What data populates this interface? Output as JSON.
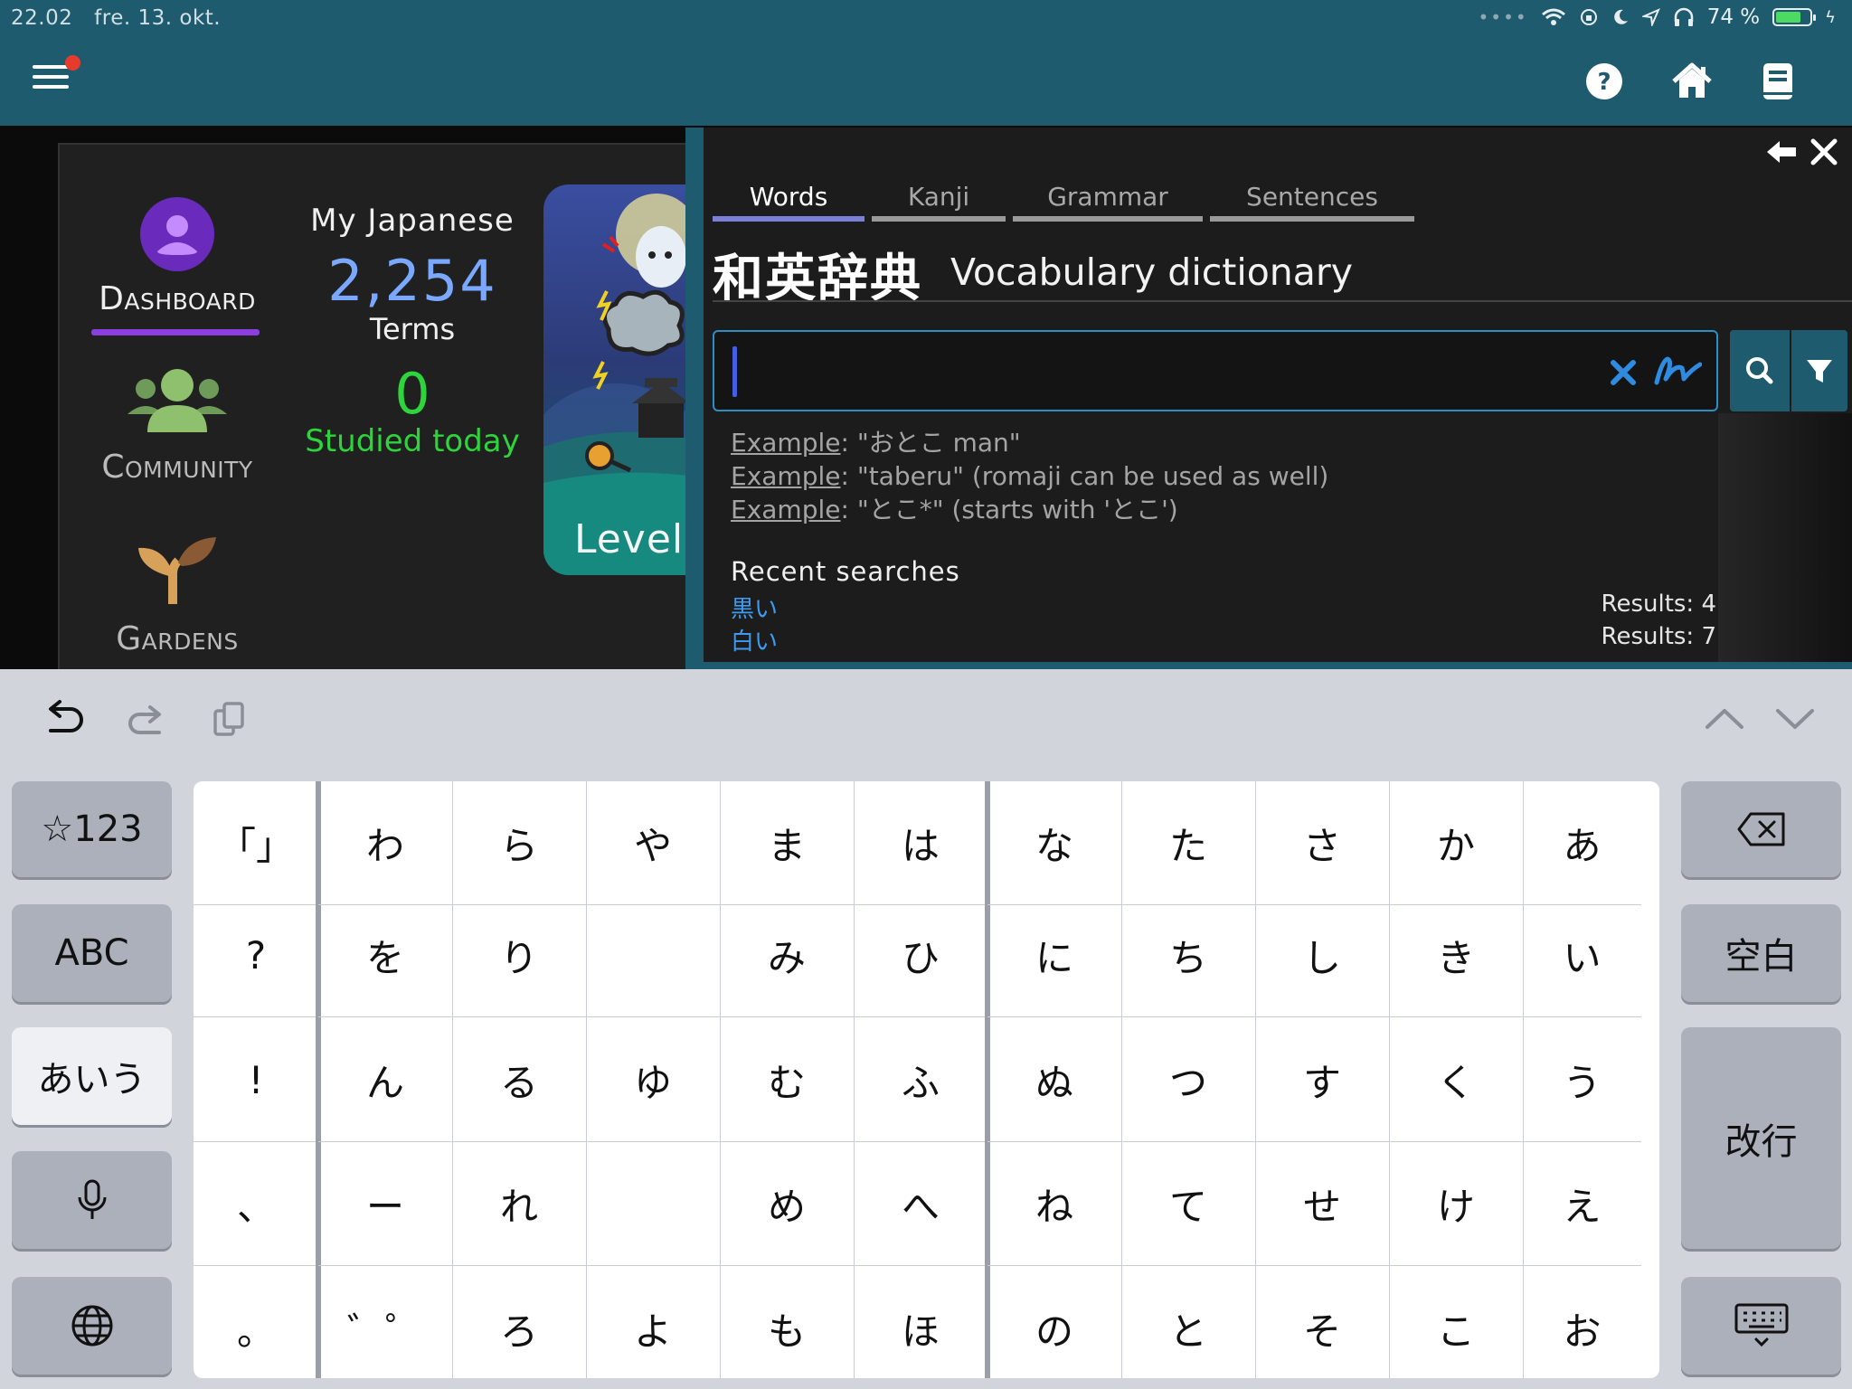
{
  "status_bar": {
    "time": "22.02",
    "date": "fre. 13. okt.",
    "battery": "74 %",
    "battery_level": 0.74
  },
  "topbar": {
    "icons": [
      "menu-icon",
      "help-icon",
      "home-icon",
      "book-icon"
    ]
  },
  "sidebar": {
    "items": [
      {
        "label": "Dashboard",
        "icon": "profile-icon"
      },
      {
        "label": "Community",
        "icon": "community-icon"
      },
      {
        "label": "Gardens",
        "icon": "sprout-icon"
      }
    ]
  },
  "stats": {
    "title": "My Japanese",
    "terms_count": "2,254",
    "terms_label": "Terms",
    "studied_count": "0",
    "studied_label": "Studied today"
  },
  "level_card": {
    "label": "Level"
  },
  "dictionary": {
    "tabs": [
      "Words",
      "Kanji",
      "Grammar",
      "Sentences"
    ],
    "active_tab": "Words",
    "title_jp": "和英辞典",
    "title_en": "Vocabulary dictionary",
    "search_value": "",
    "examples": [
      {
        "label": "Example",
        "text": ": \"おとこ man\""
      },
      {
        "label": "Example",
        "text": ": \"taberu\" (romaji can be used as well)"
      },
      {
        "label": "Example",
        "text": ": \"とこ*\" (starts with 'とこ')"
      }
    ],
    "recent_title": "Recent searches",
    "recent": [
      {
        "term": "黒い",
        "results": "Results: 4"
      },
      {
        "term": "白い",
        "results": "Results: 7"
      }
    ]
  },
  "keyboard": {
    "left_keys": [
      "☆123",
      "ABC",
      "あいう"
    ],
    "right_keys": {
      "space": "空白",
      "enter": "改行"
    },
    "columns": [
      [
        "「」",
        "?",
        "!",
        "、",
        "。"
      ],
      [
        "わ",
        "を",
        "ん",
        "ー",
        "゛゜"
      ],
      [
        "ら",
        "り",
        "る",
        "れ",
        "ろ"
      ],
      [
        "や",
        "",
        "ゆ",
        "",
        "よ"
      ],
      [
        "ま",
        "み",
        "む",
        "め",
        "も"
      ],
      [
        "は",
        "ひ",
        "ふ",
        "へ",
        "ほ"
      ],
      [
        "な",
        "に",
        "ぬ",
        "ね",
        "の"
      ],
      [
        "た",
        "ち",
        "つ",
        "て",
        "と"
      ],
      [
        "さ",
        "し",
        "す",
        "せ",
        "そ"
      ],
      [
        "か",
        "き",
        "く",
        "け",
        "こ"
      ],
      [
        "あ",
        "い",
        "う",
        "え",
        "お"
      ]
    ]
  }
}
